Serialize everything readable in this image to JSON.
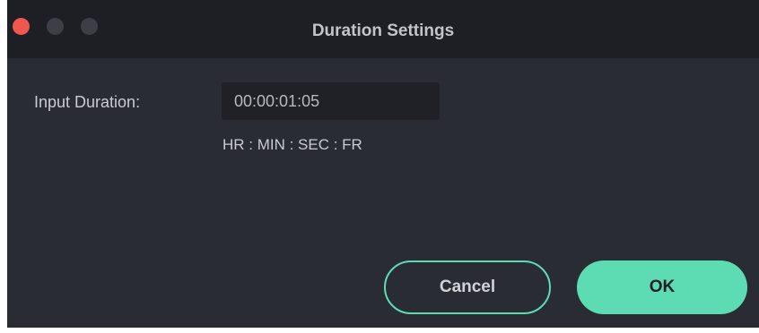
{
  "window": {
    "title": "Duration Settings"
  },
  "form": {
    "input_label": "Input Duration:",
    "duration_value": "00:00:01:05",
    "format_hint": "HR : MIN : SEC : FR"
  },
  "buttons": {
    "cancel_label": "Cancel",
    "ok_label": "OK"
  },
  "colors": {
    "accent": "#5ddcb4",
    "background": "#2a2c34",
    "titlebar": "#1d1f25",
    "close_button": "#f0574e"
  },
  "icons": {
    "close": "close-traffic-light-icon",
    "minimize": "minimize-traffic-light-icon",
    "maximize": "maximize-traffic-light-icon"
  }
}
